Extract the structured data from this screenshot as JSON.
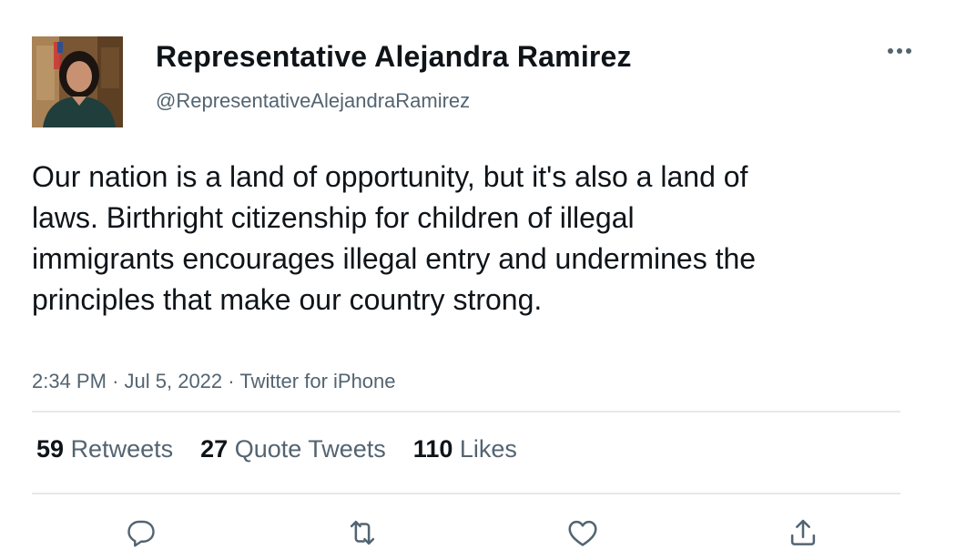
{
  "author": {
    "display_name": "Representative Alejandra Ramirez",
    "handle": "@RepresentativeAlejandraRamirez",
    "avatar_icon": "profile-photo"
  },
  "tweet": {
    "text": "Our nation is a land of opportunity, but it's also a land of laws. Birthright citizenship for children of illegal immigrants encourages illegal entry and undermines the principles that make our country strong.",
    "time": "2:34 PM",
    "date": "Jul 5, 2022",
    "source": "Twitter for iPhone",
    "separator": "·"
  },
  "stats": {
    "retweets": {
      "count": "59",
      "label": "Retweets"
    },
    "quote_tweets": {
      "count": "27",
      "label": "Quote Tweets"
    },
    "likes": {
      "count": "110",
      "label": "Likes"
    }
  },
  "actions": {
    "reply_icon": "reply-icon",
    "retweet_icon": "retweet-icon",
    "like_icon": "heart-icon",
    "share_icon": "share-icon",
    "more_icon": "more-icon"
  },
  "colors": {
    "text_primary": "#0f1419",
    "text_secondary": "#536471",
    "divider": "#e6e9eb",
    "background": "#ffffff"
  }
}
